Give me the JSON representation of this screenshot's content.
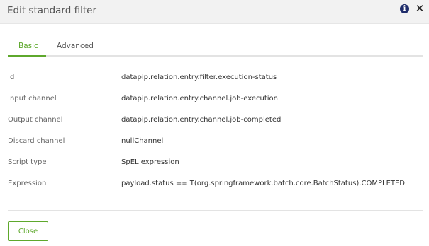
{
  "dialog": {
    "title": "Edit standard filter",
    "info_icon": "info-circle-icon",
    "close_icon": "close-icon",
    "close_glyph": "✕",
    "info_glyph": "i"
  },
  "tabs": [
    {
      "label": "Basic",
      "active": true
    },
    {
      "label": "Advanced",
      "active": false
    }
  ],
  "fields": [
    {
      "label": "Id",
      "value": "datapip.relation.entry.filter.execution-status"
    },
    {
      "label": "Input channel",
      "value": "datapip.relation.entry.channel.job-execution"
    },
    {
      "label": "Output channel",
      "value": "datapip.relation.entry.channel.job-completed"
    },
    {
      "label": "Discard channel",
      "value": "nullChannel"
    },
    {
      "label": "Script type",
      "value": "SpEL expression"
    },
    {
      "label": "Expression",
      "value": "payload.status == T(org.springframework.batch.core.BatchStatus).COMPLETED"
    }
  ],
  "footer": {
    "close_label": "Close"
  },
  "colors": {
    "accent": "#5ea82c",
    "header_bg": "#f2f2f2",
    "info_icon": "#1f2d6b"
  }
}
